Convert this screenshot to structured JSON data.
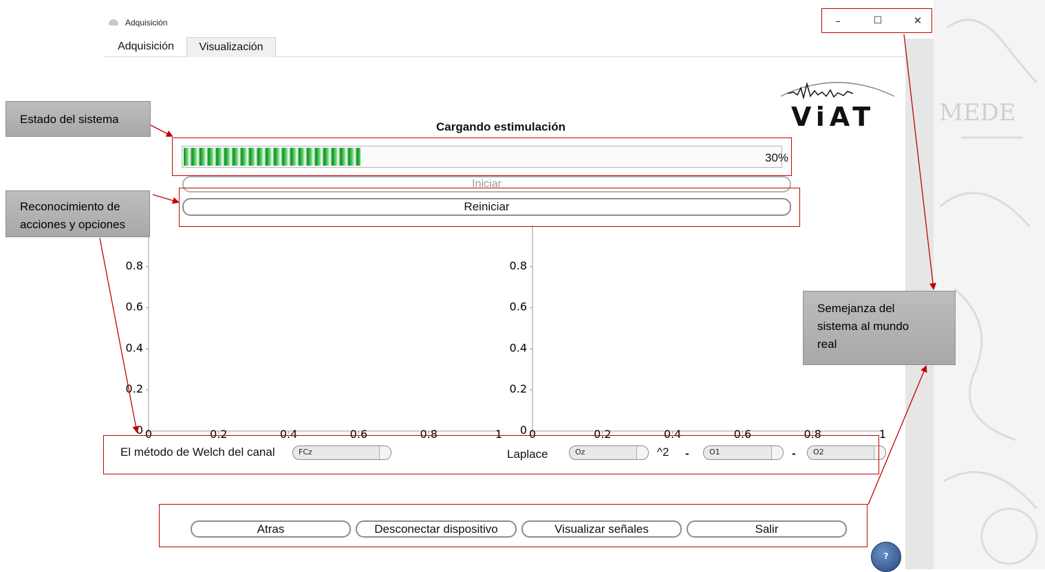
{
  "window": {
    "title": "Adquisición",
    "minimize": "–",
    "maximize": "☐",
    "close": "✕"
  },
  "tabs": [
    {
      "label": "Adquisición",
      "active": true
    },
    {
      "label": "Visualización",
      "active": false
    }
  ],
  "logo": {
    "text": "ViAT"
  },
  "status": {
    "title": "Cargando estimulación",
    "progress_percent": 30,
    "progress_label": "30%"
  },
  "buttons": {
    "iniciar": "Iniciar",
    "reiniciar": "Reiniciar",
    "atras": "Atras",
    "desconectar": "Desconectar dispositivo",
    "visualizar": "Visualizar señales",
    "salir": "Salir",
    "help": "?"
  },
  "plots": {
    "y_ticks": [
      "0",
      "0.2",
      "0.4",
      "0.6",
      "0.8"
    ],
    "x_ticks": [
      "0",
      "0.2",
      "0.4",
      "0.6",
      "0.8",
      "1"
    ]
  },
  "controls": {
    "welch_label": "El método de Welch del canal",
    "welch_channel": "FCz",
    "laplace_label": "Laplace",
    "laplace_ch1": "Oz",
    "power": "^2",
    "minus1": "-",
    "laplace_ch2": "O1",
    "minus2": "-",
    "laplace_ch3": "O2"
  },
  "annotations": {
    "estado": "Estado del sistema",
    "reconocimiento": "Reconocimiento de acciones y opciones",
    "semejanza": "Semejanza del sistema al mundo real",
    "color": "#c00000"
  }
}
